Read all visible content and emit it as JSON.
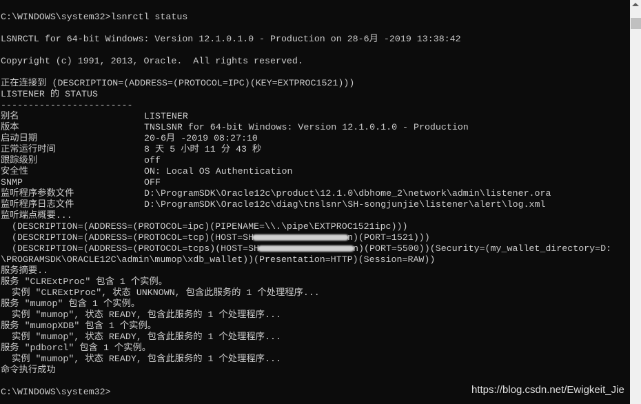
{
  "console": {
    "l0": "C:\\WINDOWS\\system32>lsnrctl status",
    "l2": "LSNRCTL for 64-bit Windows: Version 12.1.0.1.0 - Production on 28-6月 -2019 13:38:42",
    "l4": "Copyright (c) 1991, 2013, Oracle.  All rights reserved.",
    "l6": "正在连接到 (DESCRIPTION=(ADDRESS=(PROTOCOL=IPC)(KEY=EXTPROC1521)))",
    "l7": "LISTENER 的 STATUS",
    "l8": "------------------------",
    "status": [
      {
        "label": "别名",
        "value": "LISTENER"
      },
      {
        "label": "版本",
        "value": "TNSLSNR for 64-bit Windows: Version 12.1.0.1.0 - Production"
      },
      {
        "label": "启动日期",
        "value": "20-6月 -2019 08:27:10"
      },
      {
        "label": "正常运行时间",
        "value": "8 天 5 小时 11 分 43 秒"
      },
      {
        "label": "跟踪级别",
        "value": "off"
      },
      {
        "label": "安全性",
        "value": "ON: Local OS Authentication"
      },
      {
        "label": "SNMP",
        "value": "OFF"
      },
      {
        "label": "监听程序参数文件",
        "value": "D:\\ProgramSDK\\Oracle12c\\product\\12.1.0\\dbhome_2\\network\\admin\\listener.ora"
      },
      {
        "label": "监听程序日志文件",
        "value": "D:\\ProgramSDK\\Oracle12c\\diag\\tnslsnr\\SH-songjunjie\\listener\\alert\\log.xml"
      }
    ],
    "l18": "监听端点概要...",
    "l19": "  (DESCRIPTION=(ADDRESS=(PROTOCOL=ipc)(PIPENAME=\\\\.\\pipe\\EXTPROC1521ipc)))",
    "l20a": "  (DESCRIPTION=(ADDRESS=(PROTOCOL=tcp)(HOST=SH",
    "l20b": "n)(PORT=1521)))",
    "l21a": "  (DESCRIPTION=(ADDRESS=(PROTOCOL=tcps)(HOST=SH",
    "l21b": "n)(PORT=5500))(Security=(my_wallet_directory=D:",
    "l22": "\\PROGRAMSDK\\ORACLE12C\\admin\\mumop\\xdb_wallet))(Presentation=HTTP)(Session=RAW))",
    "l23": "服务摘要..",
    "l24": "服务 \"CLRExtProc\" 包含 1 个实例。",
    "l25": "  实例 \"CLRExtProc\", 状态 UNKNOWN, 包含此服务的 1 个处理程序...",
    "l26": "服务 \"mumop\" 包含 1 个实例。",
    "l27": "  实例 \"mumop\", 状态 READY, 包含此服务的 1 个处理程序...",
    "l28": "服务 \"mumopXDB\" 包含 1 个实例。",
    "l29": "  实例 \"mumop\", 状态 READY, 包含此服务的 1 个处理程序...",
    "l30": "服务 \"pdborcl\" 包含 1 个实例。",
    "l31": "  实例 \"mumop\", 状态 READY, 包含此服务的 1 个处理程序...",
    "l32": "命令执行成功",
    "l34": "C:\\WINDOWS\\system32>"
  },
  "watermark": "https://blog.csdn.net/Ewigkeit_Jie",
  "colors": {
    "background": "#0c0c0c",
    "text": "#cccccc",
    "scrollbar": "#f0f0f0"
  }
}
